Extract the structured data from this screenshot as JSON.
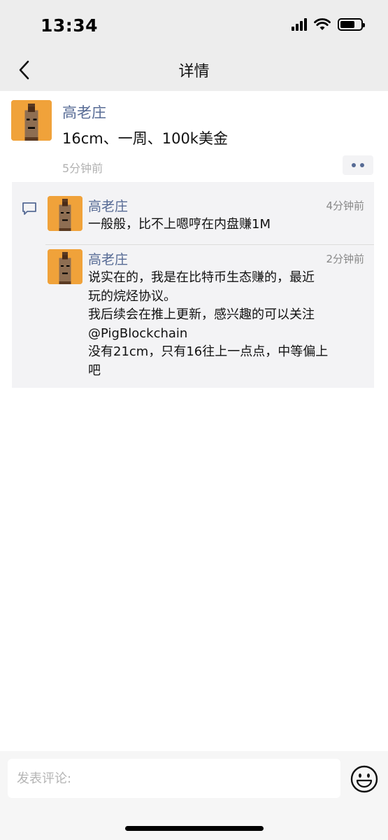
{
  "status_bar": {
    "time": "13:34"
  },
  "nav": {
    "title": "详情"
  },
  "post": {
    "author": "高老庄",
    "content": "16cm、一周、100k美金",
    "time": "5分钟前"
  },
  "comments": [
    {
      "author": "高老庄",
      "time": "4分钟前",
      "lines": [
        "一般般，比不上嗯哼在内盘赚1M"
      ]
    },
    {
      "author": "高老庄",
      "time": "2分钟前",
      "lines": [
        "说实在的，我是在比特币生态赚的，最近",
        "玩的烷烃协议。",
        "我后续会在推上更新，感兴趣的可以关注",
        "@PigBlockchain",
        "没有21cm，只有16往上一点点，中等偏上",
        "吧"
      ]
    }
  ],
  "input": {
    "placeholder": "发表评论:"
  },
  "colors": {
    "link": "#576b95",
    "avatar_bg": "#f0a23a",
    "bar_bg": "#ededed"
  }
}
